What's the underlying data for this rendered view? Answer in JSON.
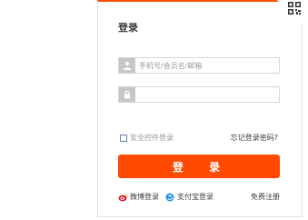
{
  "colors": {
    "accent": "#ff4a00",
    "top_border": "#ff5000"
  },
  "login": {
    "title": "登录",
    "username_placeholder": "手机号/会员名/邮箱",
    "password_placeholder": "",
    "safe_control_label": "安全控件登录",
    "forgot_password": "忘记登录密码?",
    "submit": "登 录"
  },
  "footer": {
    "weibo": "微博登录",
    "alipay": "支付宝登录",
    "register": "免费注册"
  },
  "icons": {
    "qr": "qr-code-icon",
    "user": "user-icon",
    "lock": "lock-icon",
    "weibo": "weibo-icon",
    "alipay": "alipay-icon"
  }
}
